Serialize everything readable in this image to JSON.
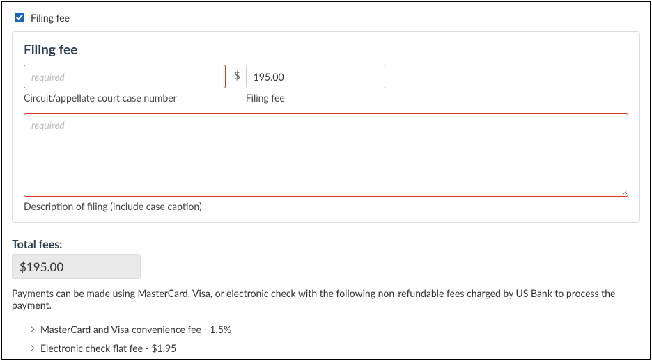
{
  "checkbox": {
    "label": "Filing fee",
    "checked": true
  },
  "panel": {
    "title": "Filing fee",
    "caseNumber": {
      "value": "",
      "placeholder": "required",
      "label": "Circuit/appellate court case number"
    },
    "currencySymbol": "$",
    "filingFee": {
      "value": "195.00",
      "label": "Filing fee"
    },
    "description": {
      "value": "",
      "placeholder": "required",
      "label": "Description of filing (include case caption)"
    }
  },
  "totals": {
    "label": "Total fees:",
    "value": "$195.00"
  },
  "disclaimer": "Payments can be made using MasterCard, Visa, or electronic check with the following non-refundable fees charged by US Bank to process the payment.",
  "feeItems": [
    "MasterCard and Visa convenience fee - 1.5%",
    "Electronic check flat fee - $1.95"
  ]
}
